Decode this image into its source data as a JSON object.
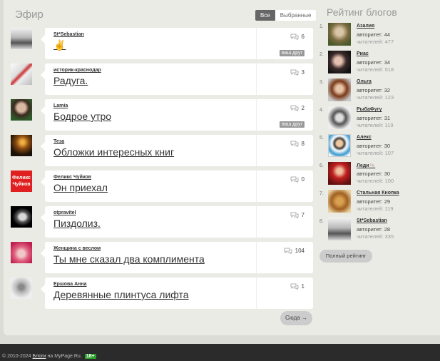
{
  "efir": {
    "title": "Эфир",
    "tabs": [
      {
        "label": "Все"
      },
      {
        "label": "Выбранные"
      }
    ],
    "items": [
      {
        "author": "St*Sebastian",
        "title": "✌️",
        "comments": "6",
        "friend": "ваш друг"
      },
      {
        "author": "историк-краснодар",
        "title": "Радуга.",
        "comments": "3",
        "friend": ""
      },
      {
        "author": "Lamia",
        "title": "Бодрое утро",
        "comments": "2",
        "friend": "ваш друг"
      },
      {
        "author": "Теза",
        "title": "Обложки интересных книг",
        "comments": "8",
        "friend": ""
      },
      {
        "author": "Феликс Чуйков",
        "title": "Он приехал",
        "comments": "0",
        "friend": "",
        "thumb_text": "Феликс Чуйков"
      },
      {
        "author": "otpravitel",
        "title": "Пиздолиз.",
        "comments": "7",
        "friend": ""
      },
      {
        "author": "Женщина с веслом",
        "title": "Ты мне сказал два комплимента",
        "comments": "104",
        "friend": ""
      },
      {
        "author": "Ершова Анна",
        "title": "Деревянные плинтуса лифта",
        "comments": "1",
        "friend": ""
      }
    ],
    "more_label": "Сюда →"
  },
  "rating": {
    "title": "Рейтинг блогов",
    "items": [
      {
        "num": "1.",
        "name": "Азалия",
        "authority": "авторитет: 44",
        "readers": "читателей: 477"
      },
      {
        "num": "2.",
        "name": "Риас",
        "authority": "авторитет: 34",
        "readers": "читателей: 518"
      },
      {
        "num": "3.",
        "name": "Ольга",
        "authority": "авторитет: 32",
        "readers": "читателей: 123"
      },
      {
        "num": "4.",
        "name": "РыбаФугу",
        "authority": "авторитет: 31",
        "readers": "читателей: 119"
      },
      {
        "num": "5.",
        "name": "Алекс",
        "authority": "авторитет: 30",
        "readers": "читателей: 107"
      },
      {
        "num": "6.",
        "name": "Леди🐚",
        "authority": "авторитет: 30",
        "readers": "читателей: 100"
      },
      {
        "num": "7.",
        "name": "Стальная Кнопка",
        "authority": "авторитет: 29",
        "readers": "читателей: 119"
      },
      {
        "num": "8.",
        "name": "St*Sebastian",
        "authority": "авторитет: 28",
        "readers": "читателей: 335"
      }
    ],
    "full_label": "Полный рейтинг"
  },
  "footer": {
    "prefix": "© 2010-2024",
    "blogs_link": "Блоги",
    "middle": "на MyPage.Ru.",
    "age_badge": "18+"
  },
  "colors": {
    "page_bg": "#ebebe6",
    "card_bg": "#ffffff",
    "footer_bg": "#2b2b2b",
    "age_badge": "#2aa02a",
    "thumb_felix": "#e02020"
  },
  "icons": {
    "comment": "speech-bubbles-icon"
  }
}
